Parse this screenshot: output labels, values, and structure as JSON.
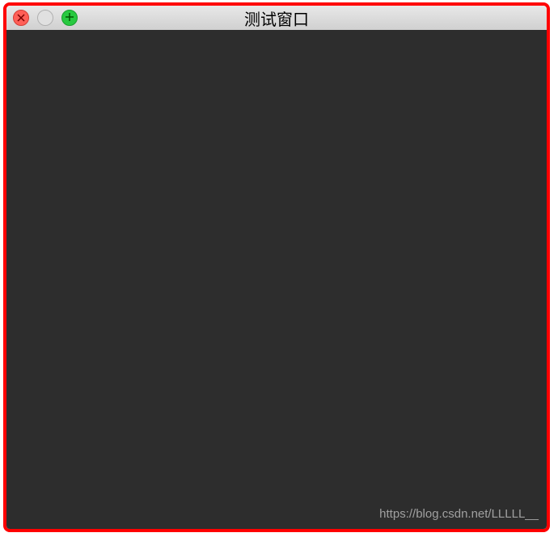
{
  "window": {
    "title": "测试窗口"
  },
  "watermark": {
    "text": "https://blog.csdn.net/LLLLL__"
  }
}
